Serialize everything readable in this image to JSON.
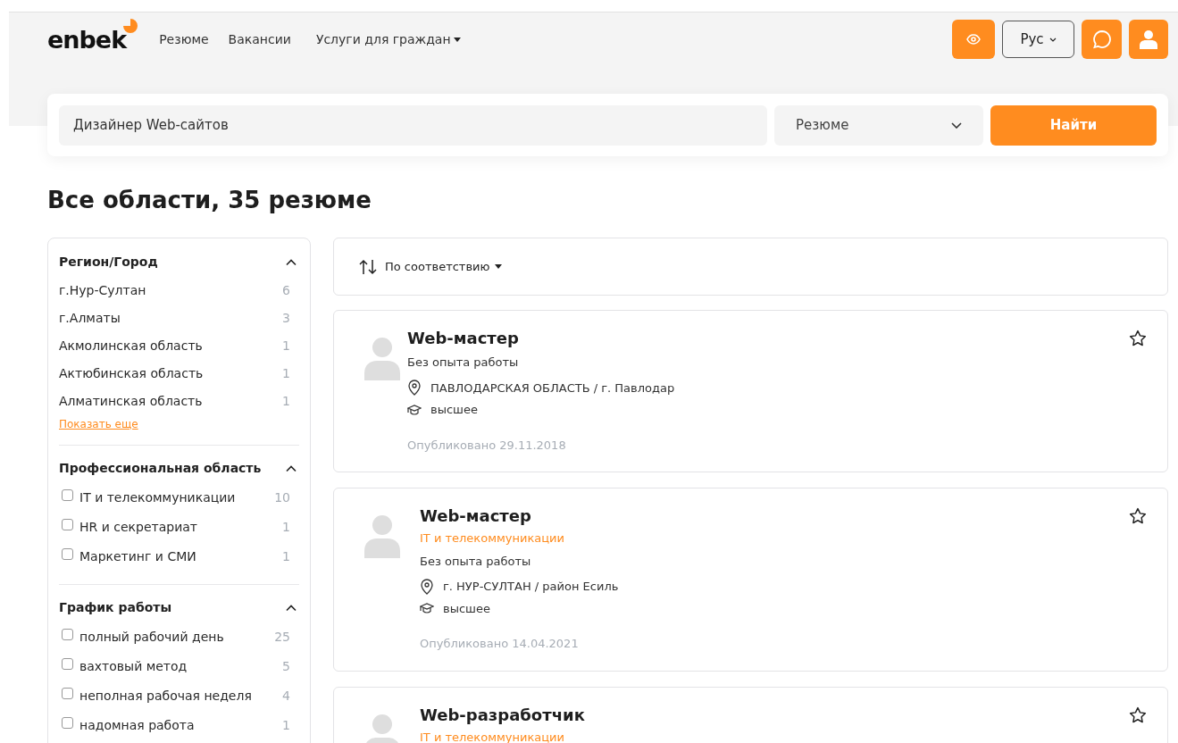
{
  "header": {
    "logo": "enbek",
    "nav": [
      {
        "label": "Резюме",
        "dropdown": false
      },
      {
        "label": "Вакансии",
        "dropdown": false
      },
      {
        "label": "Услуги для граждан",
        "dropdown": true
      }
    ],
    "language": "Рус"
  },
  "search": {
    "value": "Дизайнер Web-сайтов",
    "category": "Резюме",
    "button": "Найти"
  },
  "heading": "Все области, 35 резюме",
  "filters": [
    {
      "title": "Регион/Город",
      "expanded": true,
      "kind": "links",
      "items": [
        {
          "label": "г.Нур-Султан",
          "count": "6"
        },
        {
          "label": "г.Алматы",
          "count": "3"
        },
        {
          "label": "Акмолинская область",
          "count": "1"
        },
        {
          "label": "Актюбинская область",
          "count": "1"
        },
        {
          "label": "Алматинская область",
          "count": "1"
        }
      ],
      "more": "Показать еще"
    },
    {
      "title": "Профессиональная область",
      "expanded": true,
      "kind": "checkboxes",
      "items": [
        {
          "label": "IT и телекоммуникации",
          "count": "10",
          "checked": false
        },
        {
          "label": "HR и секретариат",
          "count": "1",
          "checked": false
        },
        {
          "label": "Маркетинг и СМИ",
          "count": "1",
          "checked": false
        }
      ]
    },
    {
      "title": "График работы",
      "expanded": true,
      "kind": "checkboxes",
      "items": [
        {
          "label": "полный рабочий день",
          "count": "25",
          "checked": false
        },
        {
          "label": "вахтовый метод",
          "count": "5",
          "checked": false
        },
        {
          "label": "неполная рабочая неделя",
          "count": "4",
          "checked": false
        },
        {
          "label": "надомная работа",
          "count": "1",
          "checked": false
        }
      ]
    }
  ],
  "sort": {
    "label": "По соответствию"
  },
  "results": [
    {
      "title": "Web-мастер",
      "experience": "Без опыта работы",
      "location": "ПАВЛОДАРСКАЯ ОБЛАСТЬ / г. Павлодар",
      "education": "высшее",
      "published": "Опубликовано 29.11.2018",
      "favorite": false
    },
    {
      "title": "Web-мастер",
      "category": "IT и телекоммуникации",
      "experience": "Без опыта работы",
      "location": "г. НУР-СУЛТАН / район Есиль",
      "education": "высшее",
      "published": "Опубликовано 14.04.2021",
      "favorite": false
    },
    {
      "title": "Web-разработчик",
      "category": "IT и телекоммуникации",
      "favorite": false
    }
  ]
}
